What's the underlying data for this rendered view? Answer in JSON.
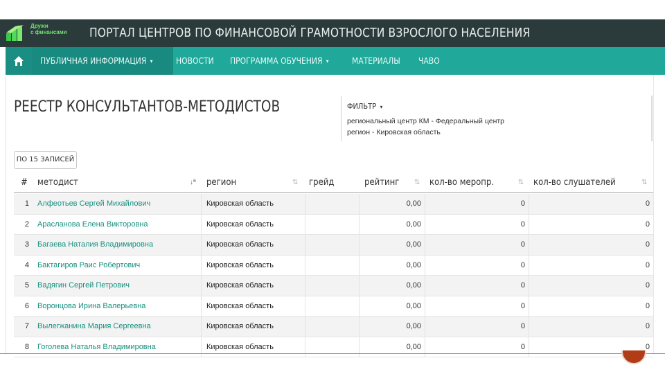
{
  "header": {
    "logo_name_line1": "Дружи",
    "logo_name_line2": "с финансами",
    "logo_tagline": "",
    "portal_title": "ПОРТАЛ ЦЕНТРОВ ПО ФИНАНСОВОЙ ГРАМОТНОСТИ ВЗРОСЛОГО НАСЕЛЕНИЯ",
    "brand_color": "#6ee36a",
    "bg_color": "#2b3a3a"
  },
  "nav": {
    "bg_color": "#20a99a",
    "home_icon": "home-icon",
    "items": [
      {
        "label": "ПУБЛИЧНАЯ ИНФОРМАЦИЯ",
        "has_dropdown": true,
        "active": true
      },
      {
        "label": "НОВОСТИ",
        "has_dropdown": false,
        "active": false
      },
      {
        "label": "ПРОГРАММА ОБУЧЕНИЯ",
        "has_dropdown": true,
        "active": false
      },
      {
        "label": "МАТЕРИАЛЫ",
        "has_dropdown": false,
        "active": false
      },
      {
        "label": "ЧАВО",
        "has_dropdown": false,
        "active": false
      }
    ]
  },
  "page": {
    "title": "РЕЕСТР КОНСУЛЬТАНТОВ-МЕТОДИСТОВ"
  },
  "filter": {
    "label": "ФИЛЬТР",
    "line1": "региональный центр КМ - Федеральный центр",
    "line2": "регион - Кировская область"
  },
  "table": {
    "per_page_label": "ПО 15 ЗАПИСЕЙ",
    "headers": [
      "#",
      "методист",
      "регион",
      "грейд",
      "рейтинг",
      "кол-во меропр.",
      "кол-во слушателей"
    ],
    "rows": [
      {
        "num": "1",
        "name": "Алфеотьев Сергей Михайлович",
        "region": "Кировская область",
        "grade": "",
        "rating": "0,00",
        "events": "0",
        "listeners": "0"
      },
      {
        "num": "2",
        "name": "Арасланова Елена Викторовна",
        "region": "Кировская область",
        "grade": "",
        "rating": "0,00",
        "events": "0",
        "listeners": "0"
      },
      {
        "num": "3",
        "name": "Багаева Наталия Владимировна",
        "region": "Кировская область",
        "grade": "",
        "rating": "0,00",
        "events": "0",
        "listeners": "0"
      },
      {
        "num": "4",
        "name": "Бактагиров Раис Робертович",
        "region": "Кировская область",
        "grade": "",
        "rating": "0,00",
        "events": "0",
        "listeners": "0"
      },
      {
        "num": "5",
        "name": "Вадягин Сергей Петрович",
        "region": "Кировская область",
        "grade": "",
        "rating": "0,00",
        "events": "0",
        "listeners": "0"
      },
      {
        "num": "6",
        "name": "Воронцова Ирина Валерьевна",
        "region": "Кировская область",
        "grade": "",
        "rating": "0,00",
        "events": "0",
        "listeners": "0"
      },
      {
        "num": "7",
        "name": "Вылегжанина Мария Сергеевна",
        "region": "Кировская область",
        "grade": "",
        "rating": "0,00",
        "events": "0",
        "listeners": "0"
      },
      {
        "num": "8",
        "name": "Гоголева Наталья Владимировна",
        "region": "Кировская область",
        "grade": "",
        "rating": "0,00",
        "events": "0",
        "listeners": "0"
      }
    ]
  },
  "slide": {
    "page_number": ""
  }
}
